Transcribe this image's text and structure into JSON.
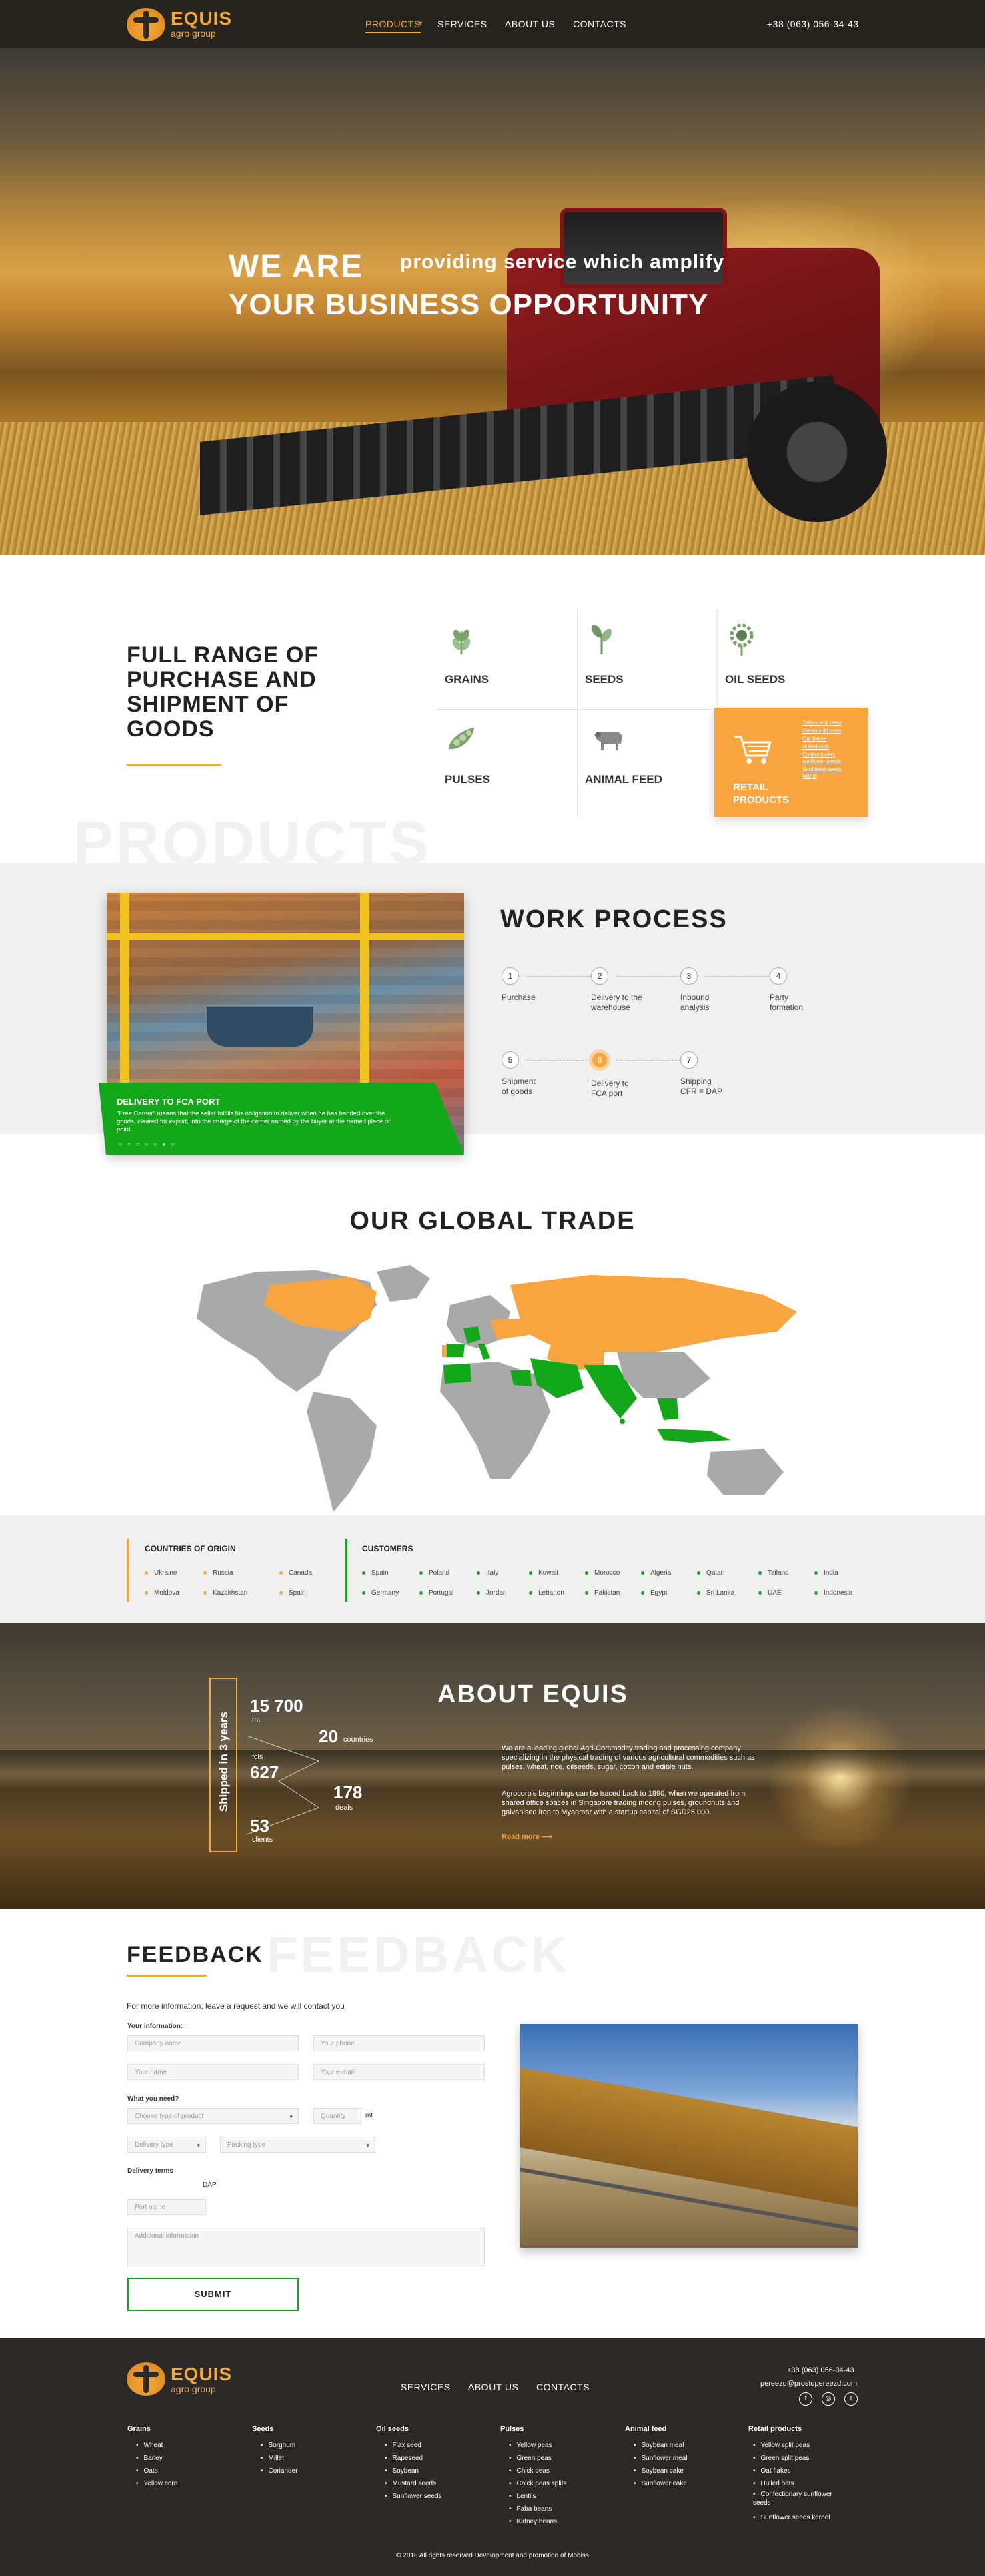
{
  "header": {
    "logo_name": "EQUIS",
    "logo_sub": "agro group",
    "nav": [
      {
        "label": "PRODUCTS",
        "active": true
      },
      {
        "label": "SERVICES"
      },
      {
        "label": "ABOUT US"
      },
      {
        "label": "CONTACTS"
      }
    ],
    "phone": "+38 (063) 056-34-43"
  },
  "hero": {
    "line1_big": "WE ARE",
    "line1_small": "providing service which amplify",
    "line2": "YOUR BUSINESS OPPORTUNITY"
  },
  "products": {
    "title": "FULL RANGE OF PURCHASE AND SHIPMENT OF GOODS",
    "ghost": "PRODUCTS",
    "items": [
      {
        "label": "GRAINS",
        "icon": "wheat-icon"
      },
      {
        "label": "SEEDS",
        "icon": "sprout-icon"
      },
      {
        "label": "OIL SEEDS",
        "icon": "sunflower-icon"
      },
      {
        "label": "PULSES",
        "icon": "peas-icon"
      },
      {
        "label": "ANIMAL FEED",
        "icon": "cow-icon"
      }
    ],
    "retail": {
      "label": "RETAIL PRODUCTS",
      "icon": "cart-icon",
      "links": [
        "Yellow split peas",
        "Green split peas",
        "Oat flakes",
        "Hulled oats",
        "Confectionery sunflower seeds",
        "Sunflower seeds kernel"
      ]
    }
  },
  "work": {
    "title": "WORK PROCESS",
    "card_title": "DELIVERY TO FCA PORT",
    "card_text": "\"Free Carrier\" means that the seller fulfills his obligation to deliver when he has handed over the goods, cleared for export, into the charge of the carrier named by the buyer at the named place or point.",
    "active_step": 6,
    "steps": [
      {
        "n": "1",
        "label": "Purchase"
      },
      {
        "n": "2",
        "label": "Delivery to the warehouse"
      },
      {
        "n": "3",
        "label": "Inbound analysis"
      },
      {
        "n": "4",
        "label": "Party formation"
      },
      {
        "n": "5",
        "label": "Shipment of goods"
      },
      {
        "n": "6",
        "label": "Delivery to FCA port"
      },
      {
        "n": "7",
        "label": "Shipping CFR ≡ DAP"
      }
    ]
  },
  "trade": {
    "title": "OUR GLOBAL TRADE",
    "colors": {
      "origin": "#f8a43f",
      "customers": "#13a81a",
      "other": "#a9a9a9"
    },
    "origin_title": "COUNTRIES OF ORIGIN",
    "origin": [
      "Ukraine",
      "Russia",
      "Canada",
      "Moldova",
      "Kazakhstan",
      "Spain"
    ],
    "customers_title": "CUSTOMERS",
    "customers": [
      "Spain",
      "Poland",
      "Italy",
      "Kuwait",
      "Morocco",
      "Algeria",
      "Qatar",
      "Tailand",
      "India",
      "Germany",
      "Portugal",
      "Jordan",
      "Lebanon",
      "Pakistan",
      "Egypt",
      "Sri Lanka",
      "UAE",
      "Indonesia"
    ]
  },
  "about": {
    "title": "ABOUT EQUIS",
    "shipped": "Shipped in 3 years",
    "stats": [
      {
        "num": "15 700",
        "unit": "mt"
      },
      {
        "num": "20",
        "unit": "countries"
      },
      {
        "num": "627",
        "unit": "fcls"
      },
      {
        "num": "178",
        "unit": "deals"
      },
      {
        "num": "53",
        "unit": "clients"
      }
    ],
    "p1": "We are a leading global Agri-Commodity trading and processing company specializing in the physical trading of various agricultural commodities such as pulses, wheat, rice, oilseeds, sugar, cotton and edible nuts.",
    "p2": "Agrocorp's beginnings can be traced back to 1990, when we operated from shared office spaces in Singapore trading moong pulses, groundnuts and galvanised iron to Myanmar with a startup capital of SGD25,000.",
    "read_more": "Read more"
  },
  "feedback": {
    "title": "FEEDBACK",
    "ghost": "FEEDBACK",
    "intro": "For more information, leave a request and we will contact you",
    "your_info": "Your information:",
    "company": "Company name",
    "phone": "Your phone",
    "name": "Your name",
    "email": "Your e-mail",
    "what_need": "What you need?",
    "product_type": "Choose type of product",
    "quantity": "Quantity",
    "unit": "mt",
    "delivery_type": "Delivery type",
    "packing_type": "Packing type",
    "delivery_terms": "Delivery terms",
    "dap": "DAP",
    "port_name": "Port name",
    "additional": "Additional information",
    "submit": "SUBMIT"
  },
  "footer": {
    "nav": [
      "SERVICES",
      "ABOUT US",
      "CONTACTS"
    ],
    "phone": "+38 (063) 056-34-43",
    "email": "pereezd@prostopereezd.com",
    "social": [
      "facebook-icon",
      "instagram-icon",
      "twitter-icon"
    ],
    "social_glyphs": [
      "f",
      "◎",
      "t"
    ],
    "columns": [
      {
        "title": "Grains",
        "items": [
          "Wheat",
          "Barley",
          "Oats",
          "Yellow corn"
        ]
      },
      {
        "title": "Seeds",
        "items": [
          "Sorghum",
          "Millet",
          "Coriander"
        ]
      },
      {
        "title": "Oil seeds",
        "items": [
          "Flax seed",
          "Rapeseed",
          "Soybean",
          "Mustard seeds",
          "Sunflower seeds"
        ]
      },
      {
        "title": "Pulses",
        "items": [
          "Yellow peas",
          "Green peas",
          "Chick peas",
          "Chick peas splits",
          "Lentils",
          "Faba beans",
          "Kidney beans"
        ]
      },
      {
        "title": "Animal feed",
        "items": [
          "Soybean meal",
          "Sunflower meal",
          "Soybean cake",
          "Sunflower cake"
        ]
      },
      {
        "title": "Retail products",
        "items": [
          "Yellow split peas",
          "Green split peas",
          "Oat flakes",
          "Hulled oats",
          "Confectionary sunflower seeds",
          "Sunflower seeds kernel"
        ]
      }
    ],
    "copyright": "© 2018 All rights reserved Development and promotion of Mobiss"
  }
}
